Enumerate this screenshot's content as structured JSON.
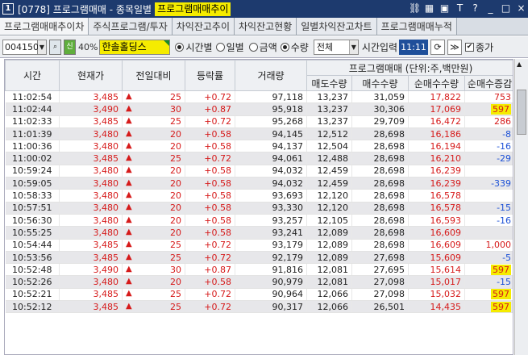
{
  "window": {
    "number": "1",
    "title": "[0778] 프로그램매매 - 종목일별",
    "highlight": "프로그램매매추이",
    "icons": [
      "link-icon",
      "chart-icon",
      "lock-icon",
      "stack-icon",
      "help-icon",
      "minimize-icon",
      "maximize-icon",
      "close-icon"
    ],
    "icon_glyphs": [
      "⛓",
      "▦",
      "▣",
      "T",
      "?",
      "_",
      "□",
      "×"
    ]
  },
  "tabs": [
    "프로그램매매추이차",
    "주식프로그램/투자",
    "차익잔고추이",
    "차익잔고현황",
    "일별차익잔고차트",
    "프로그램매매누적"
  ],
  "toolbar": {
    "code": "004150",
    "credit_badge": "신",
    "margin_pct": "40%",
    "stock_name": "한솔홀딩스",
    "radio_period": [
      "시간별",
      "일별"
    ],
    "radio_period_selected": 0,
    "radio_unit": [
      "금액",
      "수량"
    ],
    "radio_unit_selected": 1,
    "filter": "전체",
    "interval_label": "시간입력",
    "interval_value": "11:11",
    "refresh_icon": "⟳",
    "next_icon": "≫",
    "checkbox_label": "종가"
  },
  "table": {
    "headers": {
      "time": "시간",
      "price": "현재가",
      "change": "전일대비",
      "rate": "등락률",
      "volume": "거래량",
      "program_group": "프로그램매매 (단위:주,백만원)",
      "sell": "매도수량",
      "buy": "매수수량",
      "net": "순매수수량",
      "net_delta": "순매수증감"
    },
    "rows": [
      {
        "time": "11:02:54",
        "price": "3,485",
        "change": "25",
        "rate": "+0.72",
        "volume": "97,118",
        "sell": "13,237",
        "buy": "31,059",
        "net": "17,822",
        "delta": "753",
        "delta_color": "red",
        "delta_hl": false
      },
      {
        "time": "11:02:44",
        "price": "3,490",
        "change": "30",
        "rate": "+0.87",
        "volume": "95,918",
        "sell": "13,237",
        "buy": "30,306",
        "net": "17,069",
        "delta": "597",
        "delta_color": "red",
        "delta_hl": true
      },
      {
        "time": "11:02:33",
        "price": "3,485",
        "change": "25",
        "rate": "+0.72",
        "volume": "95,268",
        "sell": "13,237",
        "buy": "29,709",
        "net": "16,472",
        "delta": "286",
        "delta_color": "red",
        "delta_hl": false
      },
      {
        "time": "11:01:39",
        "price": "3,480",
        "change": "20",
        "rate": "+0.58",
        "volume": "94,145",
        "sell": "12,512",
        "buy": "28,698",
        "net": "16,186",
        "delta": "-8",
        "delta_color": "blue",
        "delta_hl": false
      },
      {
        "time": "11:00:36",
        "price": "3,480",
        "change": "20",
        "rate": "+0.58",
        "volume": "94,137",
        "sell": "12,504",
        "buy": "28,698",
        "net": "16,194",
        "delta": "-16",
        "delta_color": "blue",
        "delta_hl": false
      },
      {
        "time": "11:00:02",
        "price": "3,485",
        "change": "25",
        "rate": "+0.72",
        "volume": "94,061",
        "sell": "12,488",
        "buy": "28,698",
        "net": "16,210",
        "delta": "-29",
        "delta_color": "blue",
        "delta_hl": false
      },
      {
        "time": "10:59:24",
        "price": "3,480",
        "change": "20",
        "rate": "+0.58",
        "volume": "94,032",
        "sell": "12,459",
        "buy": "28,698",
        "net": "16,239",
        "delta": "",
        "delta_color": "blue",
        "delta_hl": false
      },
      {
        "time": "10:59:05",
        "price": "3,480",
        "change": "20",
        "rate": "+0.58",
        "volume": "94,032",
        "sell": "12,459",
        "buy": "28,698",
        "net": "16,239",
        "delta": "-339",
        "delta_color": "blue",
        "delta_hl": false
      },
      {
        "time": "10:58:33",
        "price": "3,480",
        "change": "20",
        "rate": "+0.58",
        "volume": "93,693",
        "sell": "12,120",
        "buy": "28,698",
        "net": "16,578",
        "delta": "",
        "delta_color": "blue",
        "delta_hl": false
      },
      {
        "time": "10:57:51",
        "price": "3,480",
        "change": "20",
        "rate": "+0.58",
        "volume": "93,330",
        "sell": "12,120",
        "buy": "28,698",
        "net": "16,578",
        "delta": "-15",
        "delta_color": "blue",
        "delta_hl": false
      },
      {
        "time": "10:56:30",
        "price": "3,480",
        "change": "20",
        "rate": "+0.58",
        "volume": "93,257",
        "sell": "12,105",
        "buy": "28,698",
        "net": "16,593",
        "delta": "-16",
        "delta_color": "blue",
        "delta_hl": false
      },
      {
        "time": "10:55:25",
        "price": "3,480",
        "change": "20",
        "rate": "+0.58",
        "volume": "93,241",
        "sell": "12,089",
        "buy": "28,698",
        "net": "16,609",
        "delta": "",
        "delta_color": "blue",
        "delta_hl": false
      },
      {
        "time": "10:54:44",
        "price": "3,485",
        "change": "25",
        "rate": "+0.72",
        "volume": "93,179",
        "sell": "12,089",
        "buy": "28,698",
        "net": "16,609",
        "delta": "1,000",
        "delta_color": "red",
        "delta_hl": false
      },
      {
        "time": "10:53:56",
        "price": "3,485",
        "change": "25",
        "rate": "+0.72",
        "volume": "92,179",
        "sell": "12,089",
        "buy": "27,698",
        "net": "15,609",
        "delta": "-5",
        "delta_color": "blue",
        "delta_hl": false
      },
      {
        "time": "10:52:48",
        "price": "3,490",
        "change": "30",
        "rate": "+0.87",
        "volume": "91,816",
        "sell": "12,081",
        "buy": "27,695",
        "net": "15,614",
        "delta": "597",
        "delta_color": "red",
        "delta_hl": true
      },
      {
        "time": "10:52:26",
        "price": "3,480",
        "change": "20",
        "rate": "+0.58",
        "volume": "90,979",
        "sell": "12,081",
        "buy": "27,098",
        "net": "15,017",
        "delta": "-15",
        "delta_color": "blue",
        "delta_hl": false
      },
      {
        "time": "10:52:21",
        "price": "3,485",
        "change": "25",
        "rate": "+0.72",
        "volume": "90,964",
        "sell": "12,066",
        "buy": "27,098",
        "net": "15,032",
        "delta": "597",
        "delta_color": "red",
        "delta_hl": true
      },
      {
        "time": "10:52:12",
        "price": "3,485",
        "change": "25",
        "rate": "+0.72",
        "volume": "90,317",
        "sell": "12,066",
        "buy": "26,501",
        "net": "14,435",
        "delta": "597",
        "delta_color": "red",
        "delta_hl": true
      }
    ]
  },
  "colors": {
    "up": "#d61a1a",
    "down": "#1a4fd6",
    "highlight": "#f5ec00",
    "titlebar": "#1d3a6e"
  },
  "up_icon": "▲"
}
